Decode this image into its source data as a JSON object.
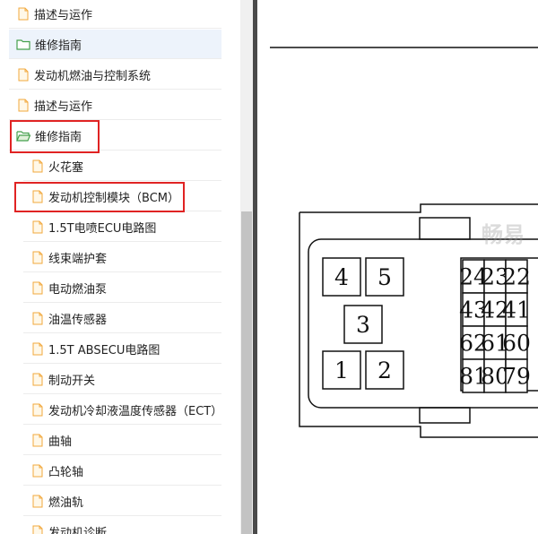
{
  "sidebar": {
    "items": [
      {
        "label": "描述与运作",
        "icon": "file-icon"
      },
      {
        "label": "维修指南",
        "icon": "folder-icon"
      },
      {
        "label": "发动机燃油与控制系统",
        "icon": "file-icon"
      },
      {
        "label": "描述与运作",
        "icon": "file-icon"
      },
      {
        "label": "维修指南",
        "icon": "folder-open-icon"
      },
      {
        "label": "火花塞",
        "icon": "file-icon"
      },
      {
        "label": "发动机控制模块（BCM）",
        "icon": "file-icon"
      },
      {
        "label": "1.5T电喷ECU电路图",
        "icon": "file-icon"
      },
      {
        "label": "线束端护套",
        "icon": "file-icon"
      },
      {
        "label": "电动燃油泵",
        "icon": "file-icon"
      },
      {
        "label": "油温传感器",
        "icon": "file-icon"
      },
      {
        "label": "1.5T ABSECU电路图",
        "icon": "file-icon"
      },
      {
        "label": "制动开关",
        "icon": "file-icon"
      },
      {
        "label": "发动机冷却液温度传感器（ECT）",
        "icon": "file-icon"
      },
      {
        "label": "曲轴",
        "icon": "file-icon"
      },
      {
        "label": "凸轮轴",
        "icon": "file-icon"
      },
      {
        "label": "燃油轨",
        "icon": "file-icon"
      },
      {
        "label": "发动机诊断",
        "icon": "file-icon"
      }
    ]
  },
  "connector": {
    "small_pins": [
      "4",
      "5",
      "3",
      "1",
      "2"
    ],
    "grid_rows": [
      [
        "24",
        "23",
        "22"
      ],
      [
        "43",
        "42",
        "41"
      ],
      [
        "62",
        "61",
        "60"
      ],
      [
        "81",
        "80",
        "79"
      ]
    ]
  },
  "watermark": {
    "text": "畅易"
  },
  "colors": {
    "highlight_box": "#e02323",
    "file_icon": "#f2a83c",
    "folder_icon": "#45a04c",
    "row_highlight": "#edf3fb"
  }
}
